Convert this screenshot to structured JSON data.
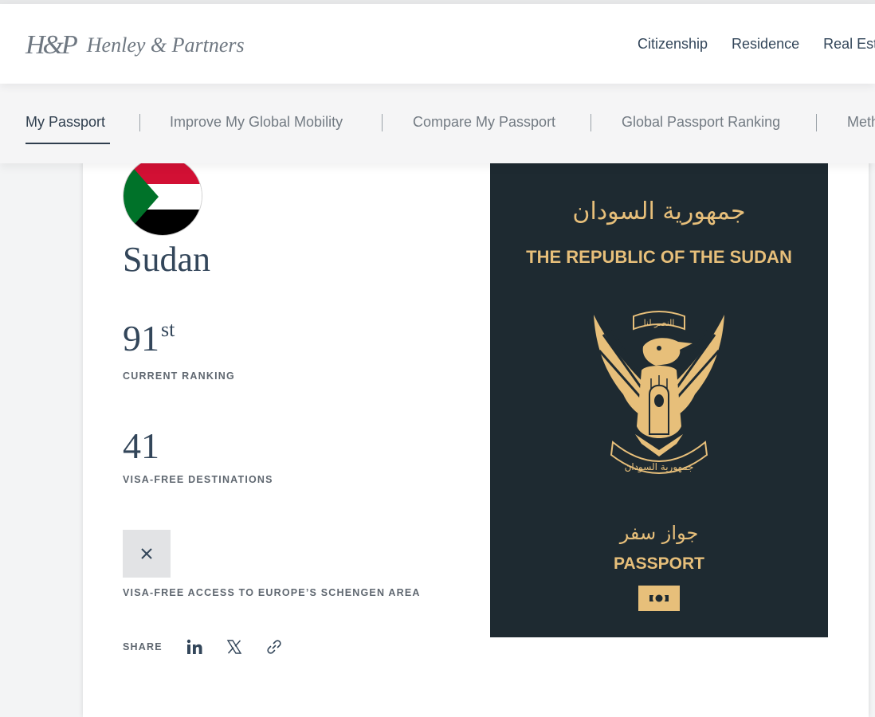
{
  "header": {
    "logo_mark": "H&P",
    "logo_text": "Henley & Partners",
    "nav": [
      "Citizenship",
      "Residence",
      "Real Estate"
    ]
  },
  "subnav": {
    "items": [
      "My Passport",
      "Improve My Global Mobility",
      "Compare My Passport",
      "Global Passport Ranking",
      "Methodology"
    ]
  },
  "country": {
    "name": "Sudan",
    "flag_colors": [
      "#d21034",
      "#ffffff",
      "#000000",
      "#007229"
    ]
  },
  "stats": {
    "ranking_number": "91",
    "ranking_suffix": "st",
    "ranking_label": "CURRENT RANKING",
    "visa_free_number": "41",
    "visa_free_label": "VISA-FREE DESTINATIONS",
    "schengen_icon": "close-icon",
    "schengen_label": "VISA-FREE ACCESS TO EUROPE’S SCHENGEN AREA"
  },
  "share": {
    "label": "SHARE",
    "icons": [
      "linkedin-icon",
      "x-twitter-icon",
      "link-icon"
    ]
  },
  "passport": {
    "arabic_title": "جمهورية السودان",
    "title": "THE REPUBLIC OF THE SUDAN",
    "emblem_banner_top": "النصر لنا",
    "emblem_banner_bottom": "جمهورية السودان",
    "arabic_passport": "جواز سفر",
    "passport_label": "PASSPORT",
    "cover_color": "#1e2a31",
    "ink_color": "#e7bf7a"
  }
}
